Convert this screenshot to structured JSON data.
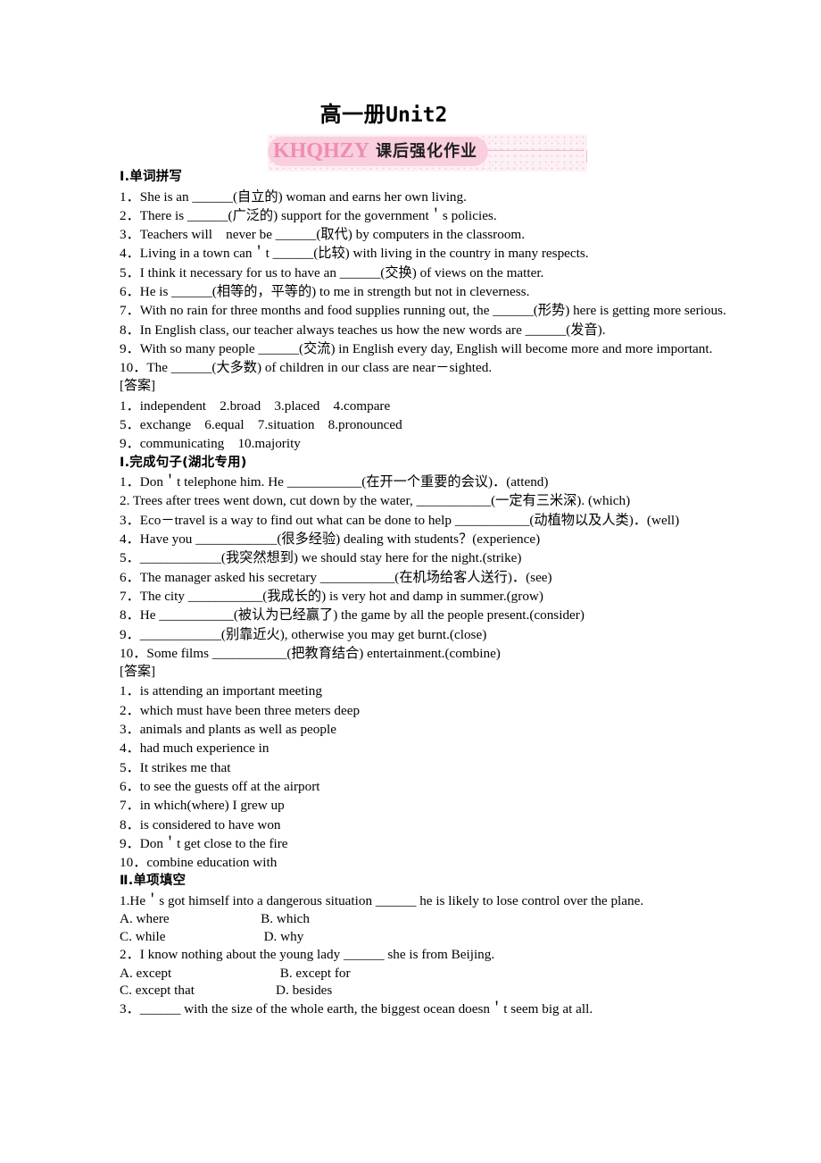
{
  "title": {
    "cn": "高一册",
    "en": "Unit2"
  },
  "banner": {
    "logo": "KHQHZY",
    "label": "课后强化作业",
    "pill_color": "#f9cfdf",
    "logo_color": "#f08cb4",
    "dot_color": "#f6c7da"
  },
  "section1": {
    "heading": "Ⅰ.单词拼写",
    "questions": [
      "1．She is an ______(自立的) woman and earns her own living.",
      "2．There is ______(广泛的) support for the government＇s policies.",
      "3．Teachers will　never be ______(取代) by computers in the classroom.",
      "4．Living in a town can＇t ______(比较) with living in the country in many respects.",
      "5．I think it necessary for us to have an ______(交换) of views on the matter.",
      "6．He is ______(相等的，平等的) to me in strength but not in cleverness.",
      "7．With no rain for three months and food supplies running out, the ______(形势) here is getting more serious.",
      "8．In English class, our teacher always teaches us how the new words are ______(发音).",
      "9．With so many people ______(交流) in English every day, English will become more and more important.",
      "10．The ______(大多数) of children in our class are near－sighted."
    ],
    "answer_label": "[答案]",
    "answers": [
      "1．independent　2.broad　3.placed　4.compare",
      "5．exchange　6.equal　7.situation　8.pronounced",
      "9．communicating　10.majority"
    ]
  },
  "section2": {
    "heading": "Ⅰ.完成句子(湖北专用)",
    "questions": [
      "1．Don＇t telephone him. He ___________(在开一个重要的会议)．(attend)",
      "2. Trees after trees went down, cut down by the water, ___________(一定有三米深). (which)",
      "3．Eco－travel is a way to find out what can be done to help ___________(动植物以及人类)．(well)",
      "4．Have you ____________(很多经验) dealing with students？(experience)",
      "5．____________(我突然想到) we should stay here for the night.(strike)",
      "6．The manager asked his secretary ___________(在机场给客人送行)．(see)",
      "7．The city ___________(我成长的) is very hot and damp in summer.(grow)",
      "8．He ___________(被认为已经赢了) the game by all the people present.(consider)",
      "9．____________(别靠近火), otherwise you may get burnt.(close)",
      "10．Some films ___________(把教育结合) entertainment.(combine)"
    ],
    "answer_label": "[答案]",
    "answers": [
      "1．is attending an important meeting",
      "2．which must have been three meters deep",
      "3．animals and plants as well as people",
      "4．had much experience in",
      "5．It strikes me that",
      "6．to see the guests off at the airport",
      "7．in which(where) I grew up",
      "8．is considered to have won",
      "9．Don＇t get close to the fire",
      "10．combine education with"
    ]
  },
  "section3": {
    "heading": "Ⅱ.单项填空",
    "items": [
      {
        "stem": "1.He＇s got himself into a dangerous situation ______ he is likely to lose control over the plane.",
        "row1": "A. where                           B. which",
        "row2": "C. while                             D. why"
      },
      {
        "stem": "2．I know nothing about the young lady ______ she is from Beijing.",
        "row1": "A. except                                B. except for",
        "row2": "C. except that                        D. besides"
      },
      {
        "stem": "3．______ with the size of the whole earth, the biggest ocean doesn＇t seem big at all.",
        "row1": "",
        "row2": ""
      }
    ]
  }
}
